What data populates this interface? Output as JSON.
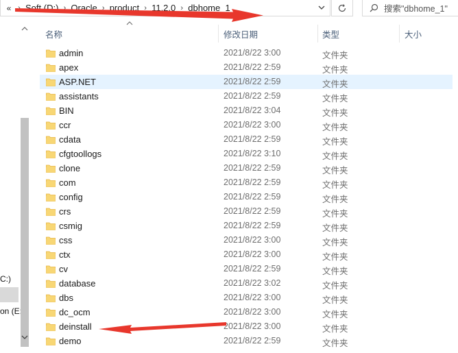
{
  "address_bar": {
    "overflow_label": "«",
    "crumbs": [
      "Soft (D:)",
      "Oracle",
      "product",
      "11.2.0",
      "dbhome_1"
    ]
  },
  "search": {
    "placeholder": "搜索\"dbhome_1\""
  },
  "nav_pane": {
    "item_c": "C:)",
    "item_e": "on (E:"
  },
  "columns": {
    "name": "名称",
    "modified": "修改日期",
    "type": "类型",
    "size": "大小"
  },
  "rows": [
    {
      "name": "admin",
      "date": "2021/8/22 3:00",
      "type": "文件夹"
    },
    {
      "name": "apex",
      "date": "2021/8/22 2:59",
      "type": "文件夹"
    },
    {
      "name": "ASP.NET",
      "date": "2021/8/22 2:59",
      "type": "文件夹"
    },
    {
      "name": "assistants",
      "date": "2021/8/22 2:59",
      "type": "文件夹"
    },
    {
      "name": "BIN",
      "date": "2021/8/22 3:04",
      "type": "文件夹"
    },
    {
      "name": "ccr",
      "date": "2021/8/22 3:00",
      "type": "文件夹"
    },
    {
      "name": "cdata",
      "date": "2021/8/22 2:59",
      "type": "文件夹"
    },
    {
      "name": "cfgtoollogs",
      "date": "2021/8/22 3:10",
      "type": "文件夹"
    },
    {
      "name": "clone",
      "date": "2021/8/22 2:59",
      "type": "文件夹"
    },
    {
      "name": "com",
      "date": "2021/8/22 2:59",
      "type": "文件夹"
    },
    {
      "name": "config",
      "date": "2021/8/22 2:59",
      "type": "文件夹"
    },
    {
      "name": "crs",
      "date": "2021/8/22 2:59",
      "type": "文件夹"
    },
    {
      "name": "csmig",
      "date": "2021/8/22 2:59",
      "type": "文件夹"
    },
    {
      "name": "css",
      "date": "2021/8/22 3:00",
      "type": "文件夹"
    },
    {
      "name": "ctx",
      "date": "2021/8/22 3:00",
      "type": "文件夹"
    },
    {
      "name": "cv",
      "date": "2021/8/22 2:59",
      "type": "文件夹"
    },
    {
      "name": "database",
      "date": "2021/8/22 3:02",
      "type": "文件夹"
    },
    {
      "name": "dbs",
      "date": "2021/8/22 3:00",
      "type": "文件夹"
    },
    {
      "name": "dc_ocm",
      "date": "2021/8/22 3:00",
      "type": "文件夹"
    },
    {
      "name": "deinstall",
      "date": "2021/8/22 3:00",
      "type": "文件夹"
    },
    {
      "name": "demo",
      "date": "2021/8/22 2:59",
      "type": "文件夹"
    }
  ],
  "highlighted_row": "ASP.NET",
  "colors": {
    "folder": "#f8d775",
    "folder_dark": "#e6b43c",
    "highlight": "#e5f3ff",
    "header_text": "#4c607a",
    "annotation": "#e8372c"
  }
}
